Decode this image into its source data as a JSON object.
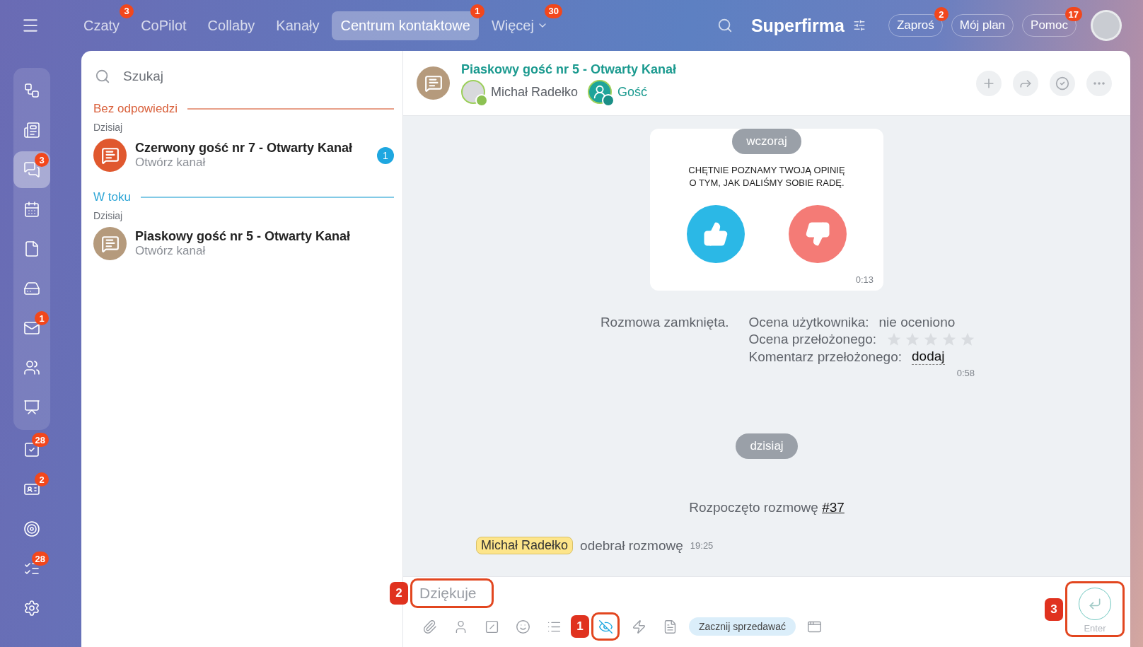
{
  "top_nav": {
    "tabs": [
      {
        "label": "Czaty",
        "badge": "3",
        "selected": false
      },
      {
        "label": "CoPilot",
        "selected": false
      },
      {
        "label": "Collaby",
        "selected": false
      },
      {
        "label": "Kanały",
        "selected": false
      },
      {
        "label": "Centrum kontaktowe",
        "badge": "1",
        "selected": true
      },
      {
        "label": "Więcej",
        "badge": "30",
        "selected": false,
        "dropdown": true
      }
    ],
    "company": "Superfirma",
    "buttons": [
      {
        "label": "Zaproś",
        "badge": "2"
      },
      {
        "label": "Mój plan"
      },
      {
        "label": "Pomoc",
        "badge": "17"
      }
    ]
  },
  "sidebar": {
    "items": [
      {
        "selected": false
      },
      {
        "selected": false
      },
      {
        "selected": true,
        "badge": "3"
      },
      {
        "selected": false
      },
      {
        "selected": false
      },
      {
        "selected": false
      },
      {
        "selected": false,
        "badge": "1"
      },
      {
        "selected": false
      },
      {
        "selected": false
      },
      {
        "selected": false,
        "badge": "28"
      },
      {
        "selected": false,
        "badge": "2"
      },
      {
        "selected": false
      },
      {
        "selected": false,
        "badge": "28"
      },
      {
        "selected": false
      }
    ]
  },
  "chat_list": {
    "search": {
      "placeholder": "Szukaj"
    },
    "groups": [
      {
        "title": "Bez odpowiedzi",
        "color": "#d9603b",
        "day": "Dzisiaj",
        "items": [
          {
            "title": "Czerwony gość nr 7 - Otwarty Kanał",
            "subtitle": "Otwórz kanał",
            "color": "#e0582e",
            "unread": "1"
          }
        ]
      },
      {
        "title": "W toku",
        "color": "#2fa6d6",
        "day": "Dzisiaj",
        "items": [
          {
            "title": "Piaskowy gość nr 5 - Otwarty Kanał",
            "subtitle": "Otwórz kanał",
            "color": "#b59a7c"
          }
        ]
      }
    ]
  },
  "chat": {
    "title": "Piaskowy gość nr 5 - Otwarty Kanał",
    "members": [
      {
        "name": "Michał Radełko",
        "kind": "operator"
      },
      {
        "name": "Gość",
        "kind": "guest"
      }
    ],
    "messages": [
      {
        "kind": "date",
        "text": "wczoraj"
      },
      {
        "kind": "rating_request",
        "lines": [
          "CHĘTNIE POZNAMY TWOJĄ OPINIĘ",
          "O TYM, JAK DALIŚMY SOBIE RADĘ."
        ],
        "time": "0:13"
      },
      {
        "kind": "closed",
        "status": "Rozmowa zamknięta.",
        "rows": [
          {
            "label": "Ocena użytkownika:",
            "value": "nie oceniono"
          },
          {
            "label": "Ocena przełożonego:",
            "stars": 0
          },
          {
            "label": "Komentarz przełożonego:",
            "link": "dodaj"
          }
        ],
        "time": "0:58"
      },
      {
        "kind": "date",
        "text": "dzisiaj"
      },
      {
        "kind": "started",
        "text": "Rozpoczęto rozmowę",
        "link": "#37"
      },
      {
        "kind": "accepted",
        "name": "Michał Radełko",
        "text": "odebrał rozmowę",
        "time": "19:25"
      }
    ],
    "composer": {
      "placeholder": "Dziękuje",
      "annotation": "2",
      "tools": [
        {
          "kind": "icon",
          "highlighted": false
        },
        {
          "kind": "icon",
          "highlighted": false
        },
        {
          "kind": "icon",
          "highlighted": false
        },
        {
          "kind": "icon",
          "highlighted": false
        },
        {
          "kind": "icon",
          "highlighted": false
        },
        {
          "kind": "icon",
          "highlighted": true,
          "annotation": "1"
        },
        {
          "kind": "icon",
          "highlighted": false
        },
        {
          "kind": "icon",
          "highlighted": false
        },
        {
          "kind": "pill",
          "label": "Zacznij sprzedawać"
        },
        {
          "kind": "icon",
          "highlighted": false
        }
      ],
      "send": {
        "hint": "Enter",
        "annotation": "3"
      }
    }
  }
}
